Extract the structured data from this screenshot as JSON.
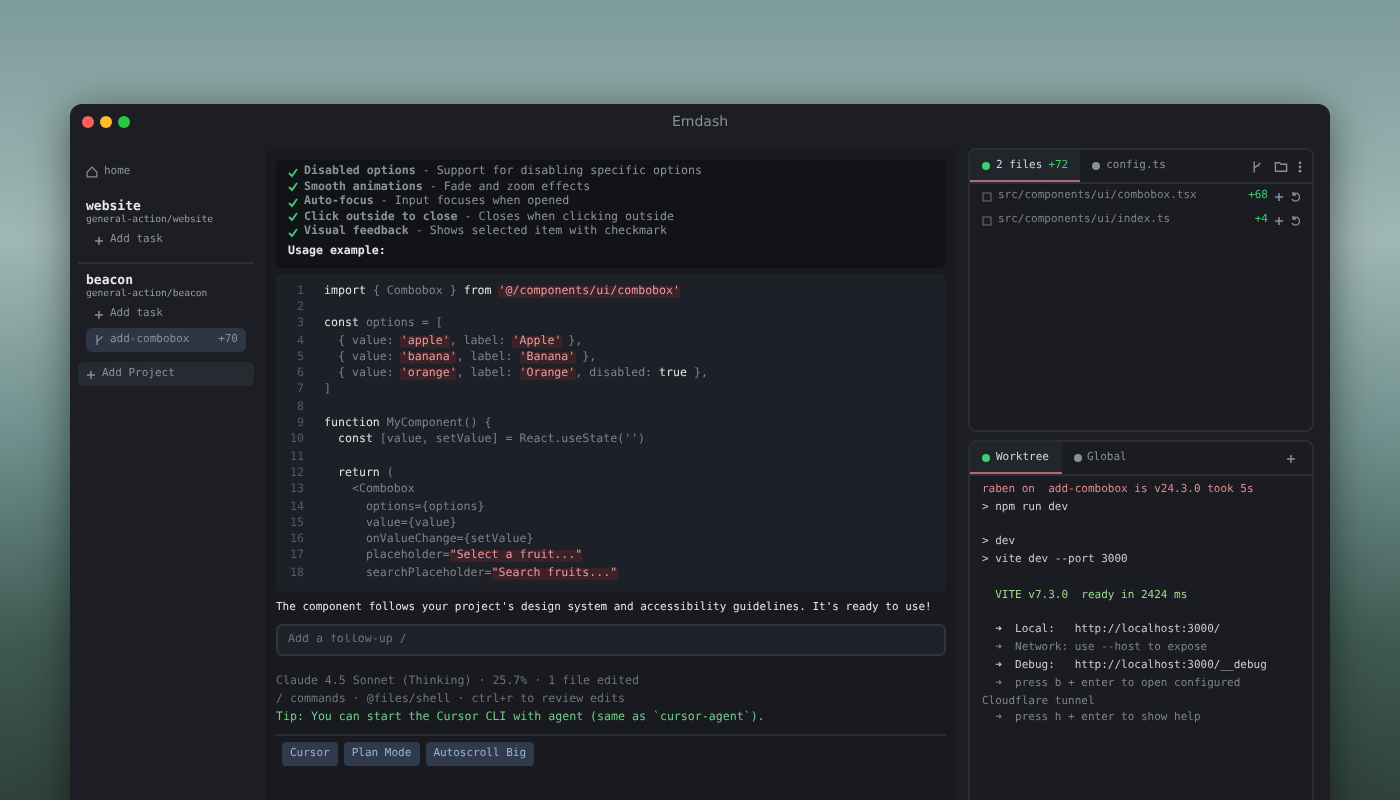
{
  "window": {
    "title": "Emdash"
  },
  "sidebar": {
    "home": "home",
    "projects": [
      {
        "name": "website",
        "path": "general-action/website",
        "add_task": "Add task"
      },
      {
        "name": "beacon",
        "path": "general-action/beacon",
        "add_task": "Add task",
        "tasks": [
          {
            "name": "add-combobox",
            "diff": "+70",
            "selected": true
          }
        ]
      }
    ],
    "add_project": "Add Project"
  },
  "chat": {
    "features": [
      "**Disabled options** - Support for disabling specific options",
      "**Smooth animations** - Fade and zoom effects",
      "**Auto-focus** - Input focuses when opened",
      "**Click outside to close** - Closes when clicking outside",
      "**Visual feedback** - Shows selected item with checkmark"
    ],
    "usage_heading": "Usage example:",
    "code": [
      {
        "num": "1",
        "tokens": [
          {
            "kind": "keyword",
            "text": "import"
          },
          {
            "kind": "plain",
            "text": " { Combobox } "
          },
          {
            "kind": "keyword",
            "text": "from "
          },
          {
            "kind": "string",
            "text": "'@/components/ui/combobox'"
          }
        ]
      },
      {
        "num": "2"
      },
      {
        "num": "3",
        "tokens": [
          {
            "kind": "keyword",
            "text": "const"
          },
          {
            "kind": "plain",
            "text": " options = ["
          }
        ]
      },
      {
        "num": "4",
        "tokens": [
          {
            "kind": "plain",
            "text": "  { value: "
          },
          {
            "kind": "string",
            "text": "'apple'"
          },
          {
            "kind": "plain",
            "text": ", label: "
          },
          {
            "kind": "string",
            "text": "'Apple'"
          },
          {
            "kind": "plain",
            "text": " },"
          }
        ]
      },
      {
        "num": "5",
        "tokens": [
          {
            "kind": "plain",
            "text": "  { value: "
          },
          {
            "kind": "string",
            "text": "'banana'"
          },
          {
            "kind": "plain",
            "text": ", label: "
          },
          {
            "kind": "string",
            "text": "'Banana'"
          },
          {
            "kind": "plain",
            "text": " },"
          }
        ]
      },
      {
        "num": "6",
        "tokens": [
          {
            "kind": "plain",
            "text": "  { value: "
          },
          {
            "kind": "string",
            "text": "'orange'"
          },
          {
            "kind": "plain",
            "text": ", label: "
          },
          {
            "kind": "string",
            "text": "'Orange'"
          },
          {
            "kind": "plain",
            "text": ", disabled: "
          },
          {
            "kind": "keyword",
            "text": "true"
          },
          {
            "kind": "plain",
            "text": " },"
          }
        ]
      },
      {
        "num": "7",
        "tokens": [
          {
            "kind": "plain",
            "text": "]"
          }
        ]
      },
      {
        "num": "8"
      },
      {
        "num": "9",
        "tokens": [
          {
            "kind": "keyword",
            "text": "function"
          },
          {
            "kind": "plain",
            "text": " MyComponent() {"
          }
        ]
      },
      {
        "num": "10",
        "tokens": [
          {
            "kind": "keyword",
            "text": "  const"
          },
          {
            "kind": "plain",
            "text": " [value, setValue] = React.useState('')"
          }
        ]
      },
      {
        "num": "11"
      },
      {
        "num": "12",
        "tokens": [
          {
            "kind": "keyword",
            "text": "  return"
          },
          {
            "kind": "plain",
            "text": " ("
          }
        ]
      },
      {
        "num": "13",
        "tokens": [
          {
            "kind": "plain",
            "text": "    <Combobox"
          }
        ]
      },
      {
        "num": "14",
        "tokens": [
          {
            "kind": "plain",
            "text": "      options={options}"
          }
        ]
      },
      {
        "num": "15",
        "tokens": [
          {
            "kind": "plain",
            "text": "      value={value}"
          }
        ]
      },
      {
        "num": "16",
        "tokens": [
          {
            "kind": "plain",
            "text": "      onValueChange={setValue}"
          }
        ]
      },
      {
        "num": "17",
        "tokens": [
          {
            "kind": "plain",
            "text": "      placeholder="
          },
          {
            "kind": "string",
            "text": "\"Select a fruit...\""
          }
        ]
      },
      {
        "num": "18",
        "tokens": [
          {
            "kind": "plain",
            "text": "      searchPlaceholder="
          },
          {
            "kind": "string",
            "text": "\"Search fruits...\""
          }
        ]
      }
    ],
    "summary": "The component follows your project's design system and accessibility guidelines. It's ready to use!",
    "input": {
      "placeholder": "Add a follow-up /"
    },
    "status": [
      "Claude 4.5 Sonnet (Thinking) · 25.7% · 1 file edited",
      "/ commands · @files/shell · ctrl+r to review edits"
    ],
    "tip": "Tip: You can start the Cursor CLI with agent (same as `cursor-agent`).",
    "buttons": [
      "Cursor",
      "Plan Mode",
      "Autoscroll Big"
    ]
  },
  "changes": {
    "tabs": [
      {
        "label": "2 files",
        "diff": "+72",
        "selected": true
      },
      {
        "label": "config.ts",
        "selected": false
      }
    ],
    "files": [
      {
        "path": "src/components/ui/combobox.tsx",
        "diff": "+68"
      },
      {
        "path": "src/components/ui/index.ts",
        "diff": "+4"
      }
    ]
  },
  "terminal": {
    "tabs": [
      {
        "label": "Worktree",
        "selected": true
      },
      {
        "label": "Global",
        "selected": false
      }
    ],
    "lines": [
      {
        "kind": "prompt",
        "text": "raben on  add-combobox is v24.3.0 took 5s"
      },
      {
        "kind": "command",
        "text": "> npm run dev"
      },
      {
        "kind": "blank"
      },
      {
        "kind": "output",
        "text": "> dev"
      },
      {
        "kind": "output",
        "text": "> vite dev --port 3000"
      },
      {
        "kind": "blank"
      },
      {
        "kind": "accent",
        "text": "  VITE v7.3.0  ready in 2424 ms"
      },
      {
        "kind": "blank"
      },
      {
        "kind": "output",
        "text": "  ➜  Local:   http://localhost:3000/"
      },
      {
        "kind": "dim",
        "text": "  ➜  Network: use --host to expose"
      },
      {
        "kind": "output",
        "text": "  ➜  Debug:   http://localhost:3000/__debug"
      },
      {
        "kind": "dim",
        "text": "  ➜  press b + enter to open configured"
      },
      {
        "kind": "dim",
        "text": "Cloudflare tunnel"
      },
      {
        "kind": "dim",
        "text": "  ➜  press h + enter to show help"
      }
    ]
  }
}
